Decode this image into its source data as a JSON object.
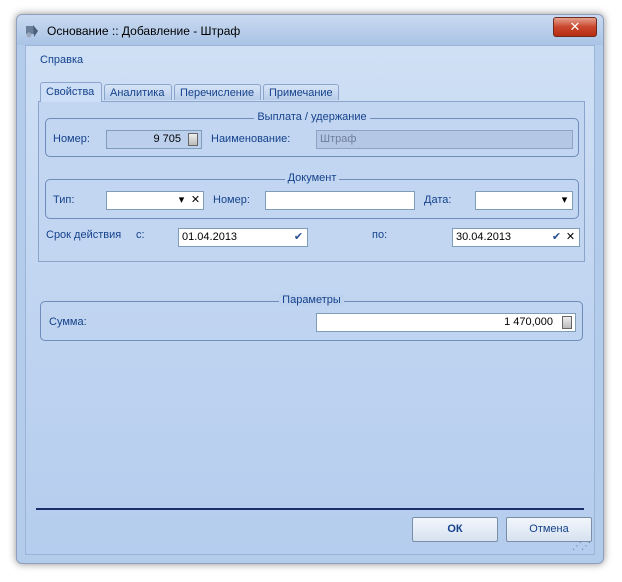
{
  "window": {
    "title": "Основание :: Добавление - Штраф",
    "close_label": "✕"
  },
  "menu": {
    "help": "Справка"
  },
  "tabs": [
    {
      "label": "Свойства",
      "active": true
    },
    {
      "label": "Аналитика",
      "active": false
    },
    {
      "label": "Перечисление",
      "active": false
    },
    {
      "label": "Примечание",
      "active": false
    }
  ],
  "payment_group": {
    "legend": "Выплата / удержание",
    "number_label": "Номер:",
    "number_value": "9 705",
    "name_label": "Наименование:",
    "name_value": "Штраф"
  },
  "document_group": {
    "legend": "Документ",
    "type_label": "Тип:",
    "type_value": "",
    "number_label": "Номер:",
    "number_value": "",
    "date_label": "Дата:",
    "date_value": ""
  },
  "validity": {
    "label": "Срок действия",
    "from_label": "с:",
    "from_value": "01.04.2013",
    "to_label": "по:",
    "to_value": "30.04.2013"
  },
  "params_group": {
    "legend": "Параметры",
    "sum_label": "Сумма:",
    "sum_value": "1 470,000"
  },
  "buttons": {
    "ok": "ОК",
    "cancel": "Отмена"
  },
  "icons": {
    "dropdown": "▾",
    "check": "✔",
    "clear": "✕"
  },
  "colors": {
    "accent": "#15428b",
    "client_bg": "#c2d6f2",
    "close_red": "#c9462c"
  }
}
